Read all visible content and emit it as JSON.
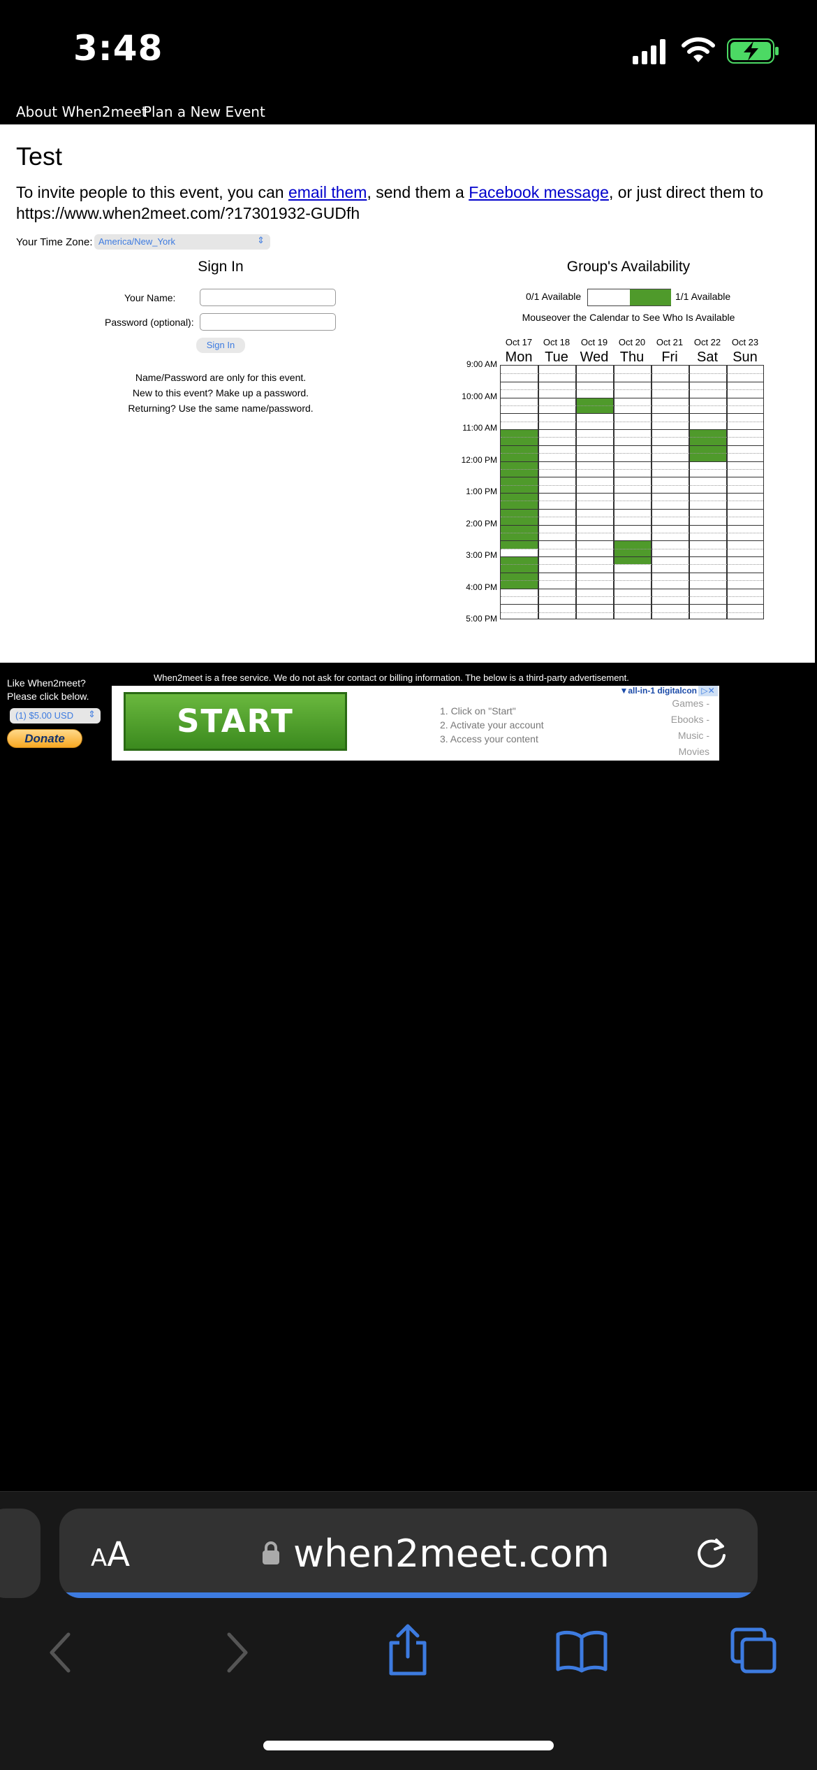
{
  "status_bar": {
    "time": "3:48",
    "icons": [
      "cellular-signal-icon",
      "wifi-icon",
      "battery-charging-icon"
    ]
  },
  "nav": {
    "about": "About When2meet",
    "plan": "Plan a New Event"
  },
  "event": {
    "title": "Test",
    "invite_prefix": "To invite people to this event, you can ",
    "email_link": "email them",
    "invite_mid": ", send them a ",
    "facebook_link": "Facebook message",
    "invite_suffix": ", or just direct them to https://www.when2meet.com/?17301932-GUDfh"
  },
  "timezone": {
    "label": "Your Time Zone:",
    "value": "America/New_York"
  },
  "sign_in": {
    "heading": "Sign In",
    "name_label": "Your Name:",
    "name_value": "",
    "password_label": "Password (optional):",
    "password_value": "",
    "button": "Sign In",
    "notes": [
      "Name/Password are only for this event.",
      "New to this event? Make up a password.",
      "Returning? Use the same name/password."
    ]
  },
  "availability": {
    "heading": "Group's Availability",
    "legend_min": "0/1 Available",
    "legend_max": "1/1 Available",
    "hint": "Mouseover the Calendar to See Who Is Available",
    "available_color": "#4f9a2b",
    "days": [
      {
        "date": "Oct 17",
        "dow": "Mon"
      },
      {
        "date": "Oct 18",
        "dow": "Tue"
      },
      {
        "date": "Oct 19",
        "dow": "Wed"
      },
      {
        "date": "Oct 20",
        "dow": "Thu"
      },
      {
        "date": "Oct 21",
        "dow": "Fri"
      },
      {
        "date": "Oct 22",
        "dow": "Sat"
      },
      {
        "date": "Oct 23",
        "dow": "Sun"
      }
    ],
    "times": [
      "9:00 AM",
      "10:00 AM",
      "11:00 AM",
      "12:00 PM",
      "1:00 PM",
      "2:00 PM",
      "3:00 PM",
      "4:00 PM",
      "5:00 PM"
    ],
    "available_slots": [
      {
        "day": "Oct 17",
        "start": "11:00 AM",
        "end": "2:45 PM"
      },
      {
        "day": "Oct 17",
        "start": "3:00 PM",
        "end": "4:00 PM"
      },
      {
        "day": "Oct 19",
        "start": "10:00 AM",
        "end": "10:30 AM"
      },
      {
        "day": "Oct 20",
        "start": "2:30 PM",
        "end": "3:15 PM"
      },
      {
        "day": "Oct 22",
        "start": "11:00 AM",
        "end": "12:00 PM"
      }
    ]
  },
  "footer": {
    "notice": "When2meet is a free service. We do not ask for contact or billing information. The below is a third-party advertisement.",
    "like_line1": "Like When2meet?",
    "like_line2": "Please click below.",
    "donation_amount": "(1) $5.00 USD",
    "donate_button": "Donate"
  },
  "ad": {
    "brand": "all-in-1 digitalcon",
    "start_button": "START",
    "steps": [
      "1. Click on \"Start\"",
      "2. Activate your account",
      "3. Access your content"
    ],
    "categories": [
      "Games -",
      "Ebooks -",
      "Music -",
      "Movies"
    ]
  },
  "safari": {
    "text_size_label": "AA",
    "url": "when2meet.com"
  }
}
